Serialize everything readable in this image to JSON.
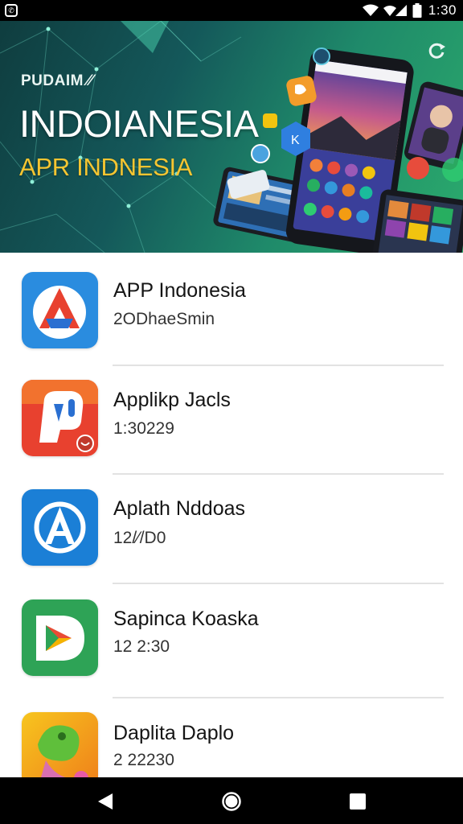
{
  "status_bar": {
    "time": "1:30",
    "icons": [
      "app-notification-icon",
      "wifi-icon",
      "signal-icon",
      "battery-icon"
    ]
  },
  "banner": {
    "brand": "PUDAIM",
    "title": "INDOIANESIA",
    "subtitle": "APR INDNESIA",
    "colors": {
      "background_start": "#0f3d3f",
      "background_end": "#2bab6c",
      "title": "#ffffff",
      "subtitle": "#f5c531"
    }
  },
  "apps": [
    {
      "name": "APP Indonesia",
      "meta": "2ODhaeSmin",
      "icon": "a-logo-icon",
      "icon_bg": "#2a8cdf"
    },
    {
      "name": "Applikp Jacls",
      "meta": "1:30229",
      "icon": "p-logo-icon",
      "icon_bg": "#e8412f"
    },
    {
      "name": "Aplath Nddoas",
      "meta": "12/⁄/D0",
      "icon": "circle-a-logo-icon",
      "icon_bg": "#1b7fd6"
    },
    {
      "name": "Sapinca Koaska",
      "meta": "12 2:30",
      "icon": "play-d-logo-icon",
      "icon_bg": "#2ea356"
    },
    {
      "name": "Daplita Daplo",
      "meta": "2 22230",
      "icon": "bird-logo-icon",
      "icon_bg": "#f2b51f"
    }
  ],
  "nav_bar": {
    "buttons": [
      "back-icon",
      "home-icon",
      "recents-icon"
    ]
  }
}
